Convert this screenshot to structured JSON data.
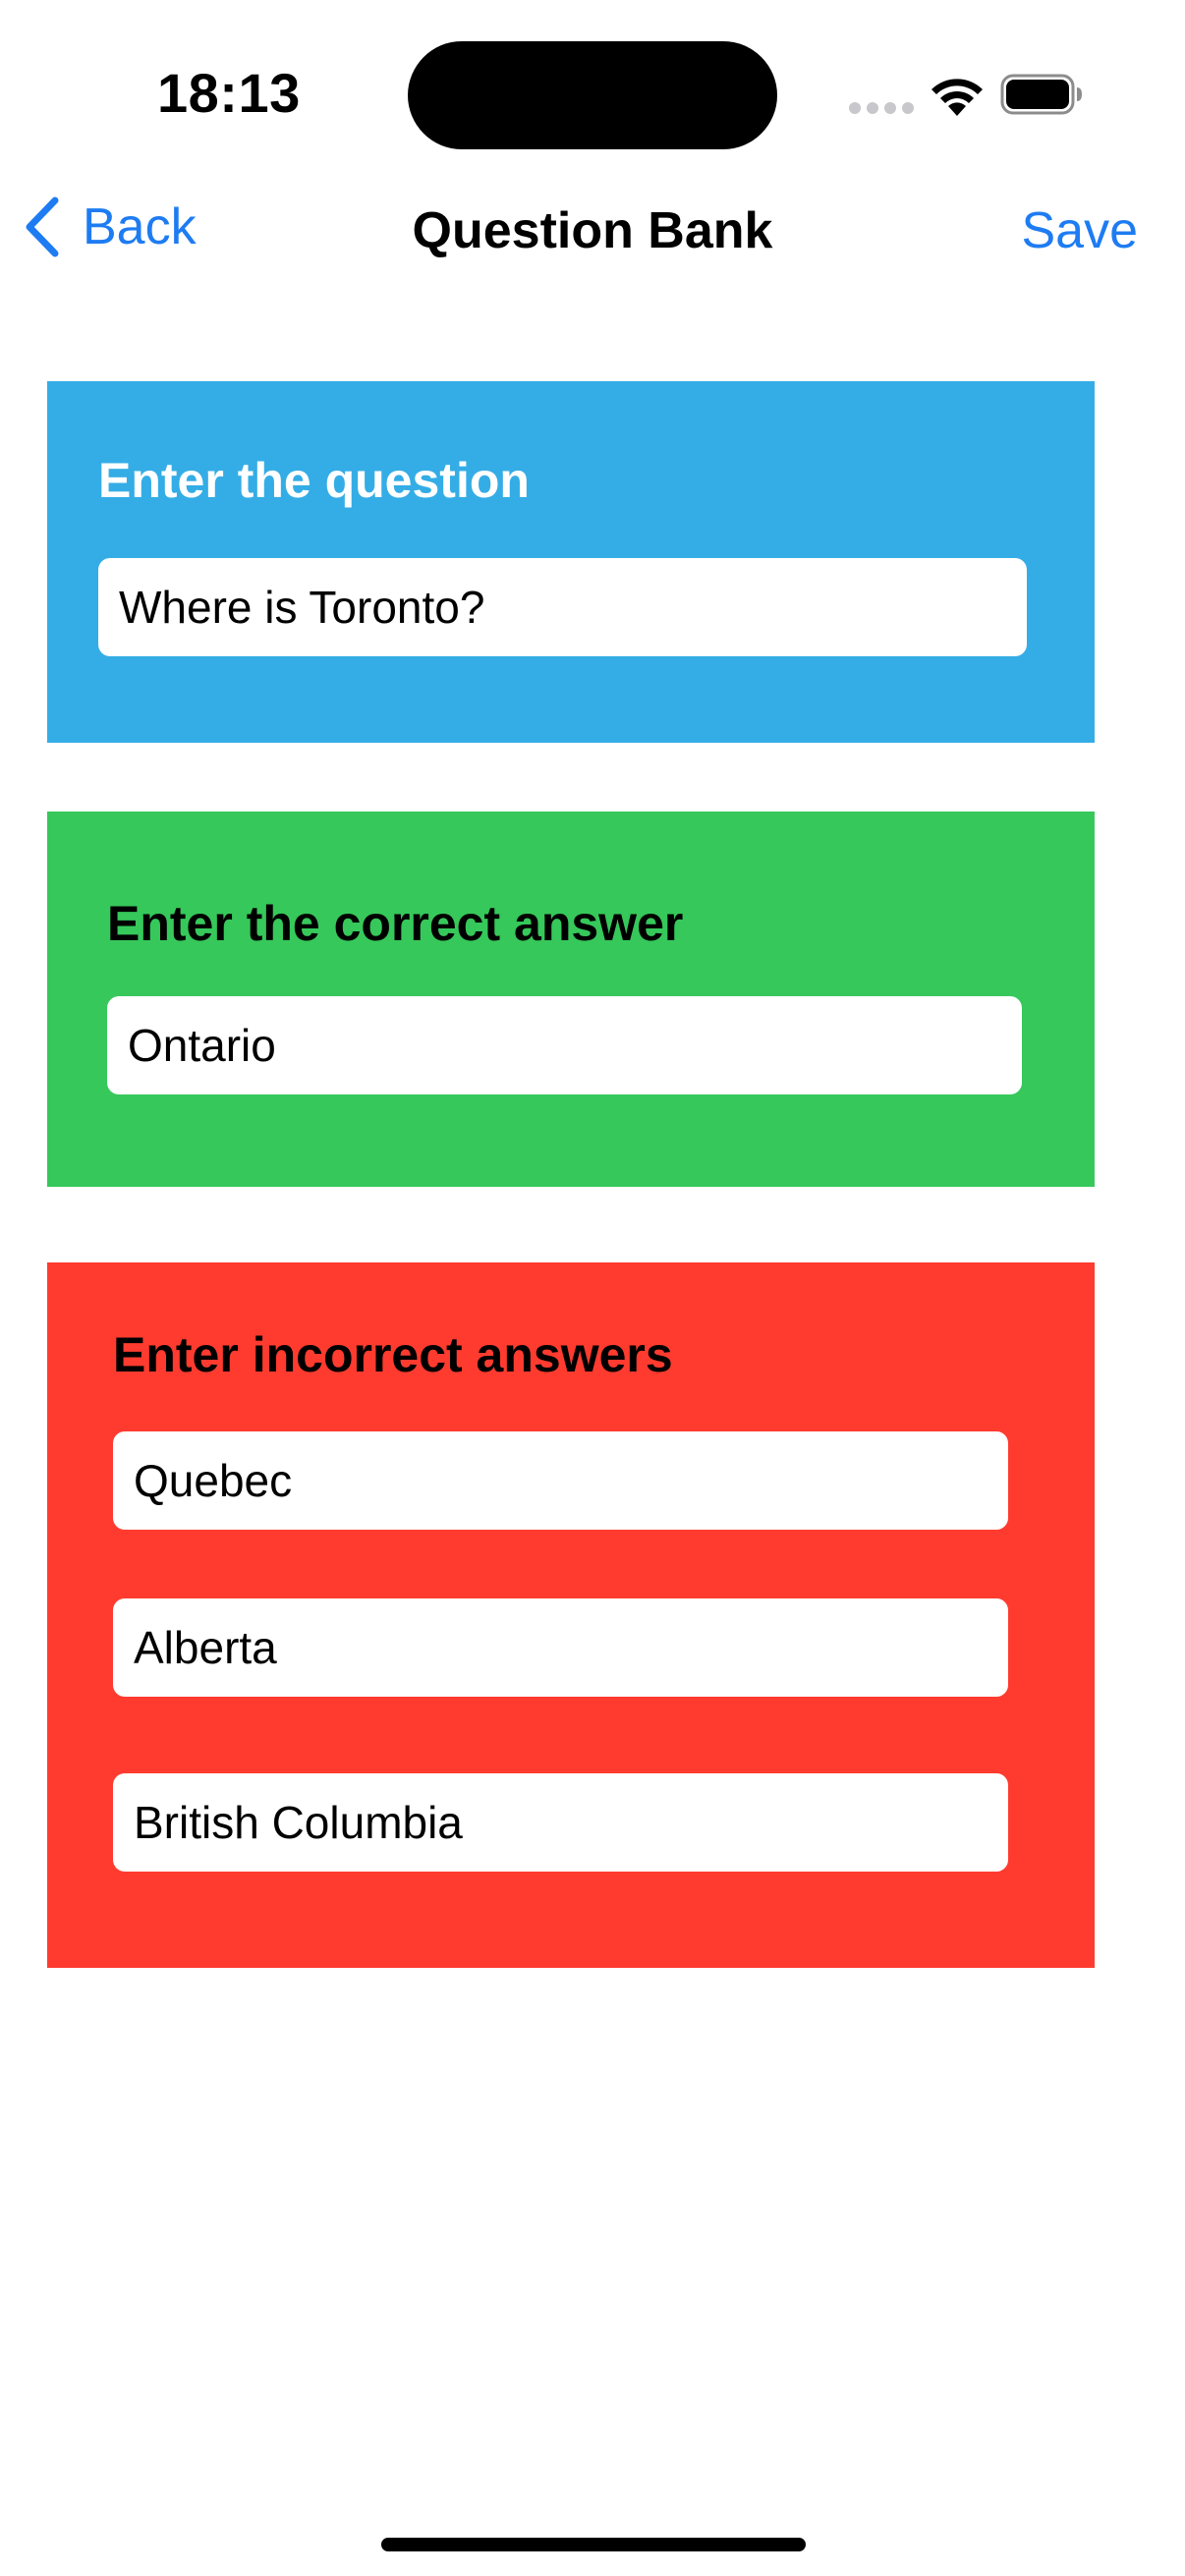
{
  "status_bar": {
    "time": "18:13",
    "icons": [
      "signal-dots-icon",
      "wifi-icon",
      "battery-icon"
    ]
  },
  "nav": {
    "back_label": "Back",
    "title": "Question Bank",
    "save_label": "Save",
    "accent_color": "#1e7cf2"
  },
  "question_card": {
    "label": "Enter the question",
    "value": "Where is Toronto?",
    "color": "#34ade6"
  },
  "correct_card": {
    "label": "Enter the correct answer",
    "value": "Ontario",
    "color": "#36c85a"
  },
  "incorrect_card": {
    "label": "Enter incorrect answers",
    "values": [
      "Quebec",
      "Alberta",
      "British Columbia"
    ],
    "color": "#ff3b2f"
  }
}
